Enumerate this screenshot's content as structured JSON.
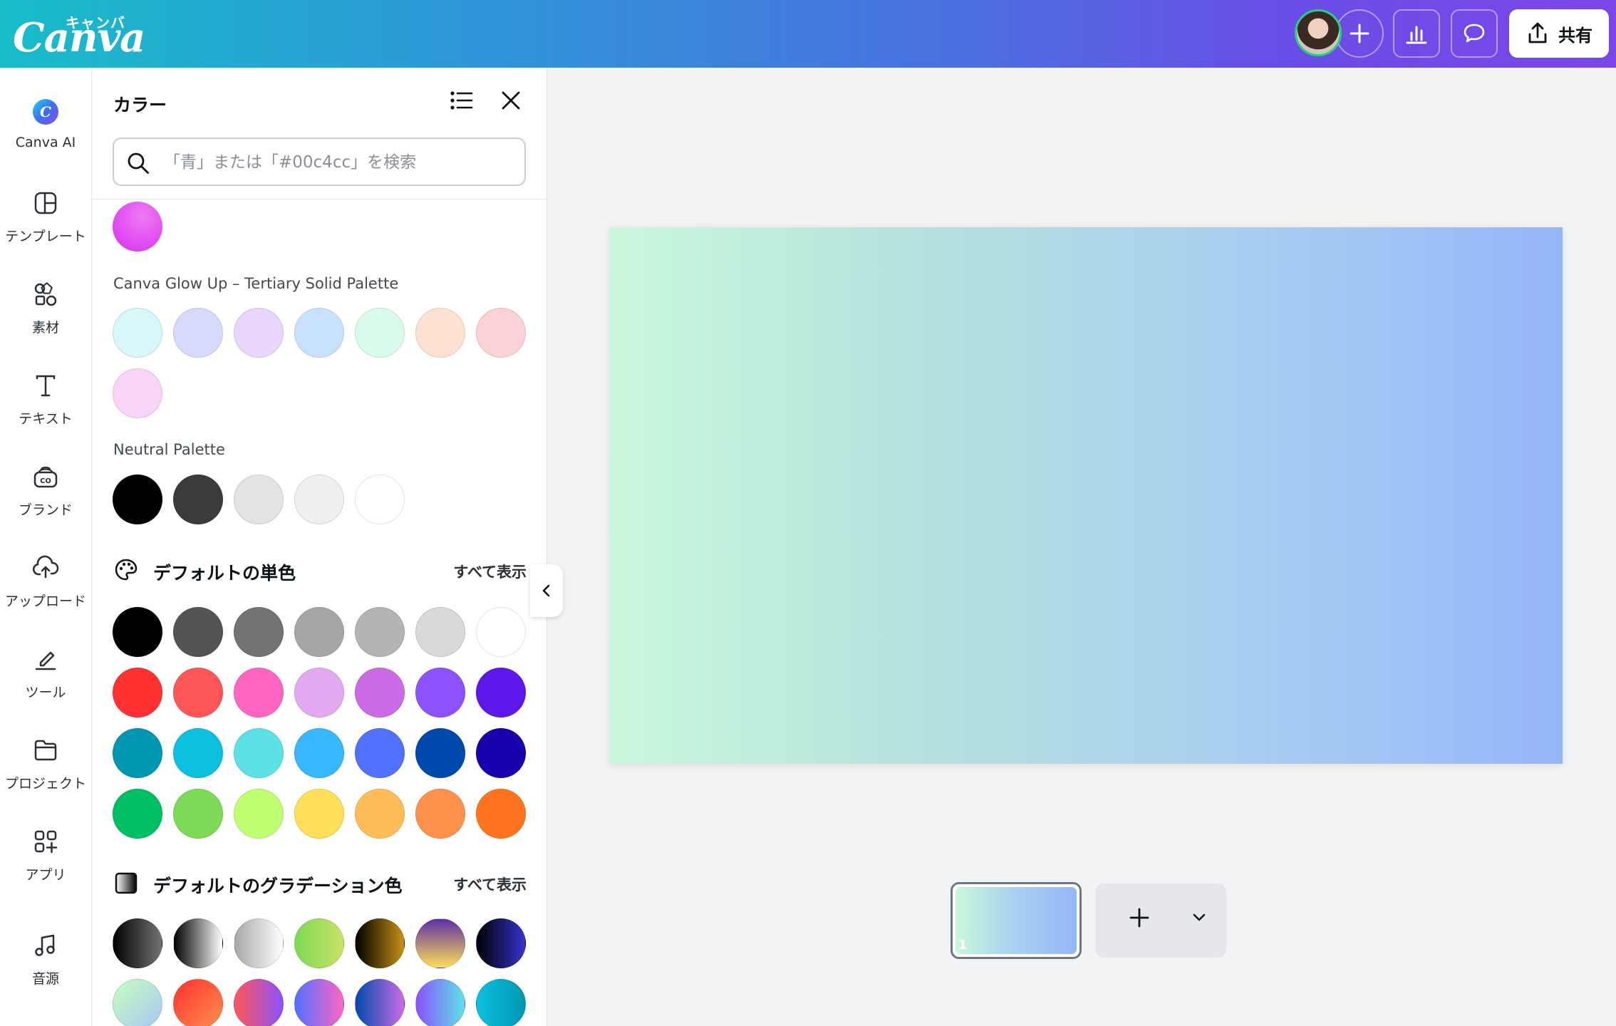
{
  "header": {
    "logo_text": "Canva",
    "logo_kana": "キャンバ",
    "share_label": "共有"
  },
  "nav": {
    "items": [
      {
        "label": "Canva AI",
        "icon": "canva-ai-icon"
      },
      {
        "label": "テンプレート",
        "icon": "template-icon"
      },
      {
        "label": "素材",
        "icon": "elements-icon"
      },
      {
        "label": "テキスト",
        "icon": "text-icon"
      },
      {
        "label": "ブランド",
        "icon": "brand-icon"
      },
      {
        "label": "アップロード",
        "icon": "upload-icon"
      },
      {
        "label": "ツール",
        "icon": "tools-icon"
      },
      {
        "label": "プロジェクト",
        "icon": "projects-icon"
      },
      {
        "label": "アプリ",
        "icon": "apps-icon"
      },
      {
        "label": "音源",
        "icon": "audio-icon"
      }
    ]
  },
  "panel": {
    "title": "カラー",
    "search_placeholder": "「青」または「#00c4cc」を検索",
    "tertiary_title": "Canva Glow Up – Tertiary Solid Palette",
    "neutral_title": "Neutral Palette",
    "default_solid_title": "デフォルトの単色",
    "default_gradient_title": "デフォルトのグラデーション色",
    "see_all": "すべて表示"
  },
  "colors": {
    "partial_top": "#e14cf2",
    "tertiary": [
      "#d8f7f9",
      "#d8dafd",
      "#ead6fd",
      "#c8e2fd",
      "#d9fbe9",
      "#fde2d2",
      "#fdd2d6",
      "#f9d4f9"
    ],
    "neutral": [
      "#000000",
      "#3b3b3b",
      "#e3e3e3",
      "#efefef",
      "#ffffff"
    ],
    "solid": [
      "#000000",
      "#545454",
      "#737373",
      "#a6a6a6",
      "#b4b4b4",
      "#d9d9d9",
      "#ffffff",
      "#ff3131",
      "#ff5757",
      "#ff66c4",
      "#e2a9f1",
      "#cb6ce6",
      "#8c52ff",
      "#5e17eb",
      "#0097b2",
      "#0cc0df",
      "#5ce1e6",
      "#38b6ff",
      "#5271ff",
      "#004aad",
      "#1800ad",
      "#00bf63",
      "#7ed957",
      "#c1ff72",
      "#ffde59",
      "#ffbd59",
      "#ff914d",
      "#ff751f"
    ],
    "gradients": [
      "linear-gradient(90deg,#000000,#737373)",
      "linear-gradient(90deg,#000000,#ffffff)",
      "linear-gradient(90deg,#a6a6a6,#ffffff)",
      "linear-gradient(90deg,#7ed957,#c9e265)",
      "linear-gradient(90deg,#000000,#c89116)",
      "linear-gradient(180deg,#5d2fa6,#ffde59)",
      "linear-gradient(90deg,#000000,#3533cd)",
      "linear-gradient(135deg,#c9ffbf,#a5c8f5)",
      "linear-gradient(135deg,#ff3131,#ff914d)",
      "linear-gradient(90deg,#ff5757,#8c52ff)",
      "linear-gradient(90deg,#5170ff,#ff66c4)",
      "linear-gradient(90deg,#004aad,#cb6ce6)",
      "linear-gradient(90deg,#8c52ff,#5ce1e6)",
      "linear-gradient(90deg,#0cc0df,#0097b2)"
    ]
  },
  "canvas": {
    "page_number": "1",
    "gradient_start": "#c9f8dc",
    "gradient_end": "#96b6fa"
  }
}
